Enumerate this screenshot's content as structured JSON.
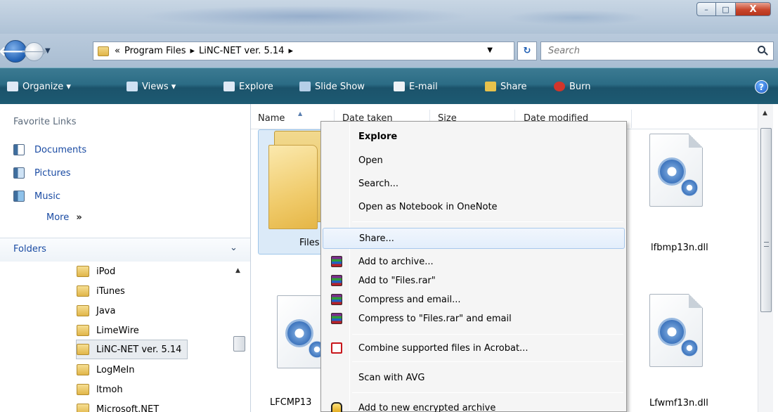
{
  "window": {
    "min_label": "–",
    "max_label": "□",
    "close_label": "X"
  },
  "address": {
    "crumb_prefix": "«",
    "crumbs": [
      "Program Files",
      "LiNC-NET ver. 5.14"
    ],
    "separator": "▸",
    "search_placeholder": "Search"
  },
  "toolbar": {
    "items": [
      {
        "label": "Organize ▾",
        "icon": "organize-icon",
        "color": "#dfe9f5"
      },
      {
        "label": "Views ▾",
        "icon": "views-icon",
        "color": "#cfe1f3"
      },
      {
        "label": "Explore",
        "icon": "explore-icon",
        "color": "#dfe9f5"
      },
      {
        "label": "Slide Show",
        "icon": "slideshow-icon",
        "color": "#b5cfe8"
      },
      {
        "label": "E-mail",
        "icon": "email-icon",
        "color": "#eef2f6"
      },
      {
        "label": "Share",
        "icon": "share-icon",
        "color": "#e7c24c"
      },
      {
        "label": "Burn",
        "icon": "burn-icon",
        "color": "#d1352b"
      }
    ],
    "help_label": "?"
  },
  "nav": {
    "favorites_heading": "Favorite Links",
    "favorites": [
      {
        "label": "Documents",
        "icon": "documents-icon"
      },
      {
        "label": "Pictures",
        "icon": "pictures-icon"
      },
      {
        "label": "Music",
        "icon": "music-icon"
      }
    ],
    "more_label": "More",
    "more_chevron": "»",
    "folders_label": "Folders",
    "folders_chevron": "⌄",
    "tree": [
      {
        "label": "iPod",
        "selected": false
      },
      {
        "label": "iTunes",
        "selected": false
      },
      {
        "label": "Java",
        "selected": false
      },
      {
        "label": "LimeWire",
        "selected": false
      },
      {
        "label": "LiNC-NET ver. 5.14",
        "selected": true
      },
      {
        "label": "LogMeIn",
        "selected": false
      },
      {
        "label": "ltmoh",
        "selected": false
      },
      {
        "label": "Microsoft.NET",
        "selected": false
      }
    ]
  },
  "files": {
    "columns": [
      "Name",
      "Date taken",
      "Size",
      "Date modified"
    ],
    "items": [
      {
        "label": "Files",
        "type": "folder"
      },
      {
        "label": "lfbmp13n.dll",
        "type": "dll"
      },
      {
        "label": "LFCMP13",
        "type": "dll"
      },
      {
        "label": "Lfwmf13n.dll",
        "type": "dll"
      }
    ]
  },
  "context_menu": {
    "items": [
      {
        "label": "Explore",
        "bold": true,
        "icon": ""
      },
      {
        "label": "Open",
        "bold": false,
        "icon": ""
      },
      {
        "label": "Search...",
        "bold": false,
        "icon": ""
      },
      {
        "label": "Open as Notebook in OneNote",
        "bold": false,
        "icon": ""
      },
      {
        "label": "Share...",
        "bold": false,
        "icon": "",
        "highlighted": true
      },
      {
        "label": "Add to archive...",
        "bold": false,
        "icon": "winrar-icon"
      },
      {
        "label": "Add to \"Files.rar\"",
        "bold": false,
        "icon": "winrar-icon"
      },
      {
        "label": "Compress and email...",
        "bold": false,
        "icon": "winrar-icon"
      },
      {
        "label": "Compress to \"Files.rar\" and email",
        "bold": false,
        "icon": "winrar-icon"
      },
      {
        "label": "Combine supported files in Acrobat...",
        "bold": false,
        "icon": "acrobat-icon"
      },
      {
        "label": "Scan with AVG",
        "bold": false,
        "icon": ""
      },
      {
        "label": "Add to new encrypted archive",
        "bold": false,
        "icon": "lock-icon"
      }
    ]
  }
}
